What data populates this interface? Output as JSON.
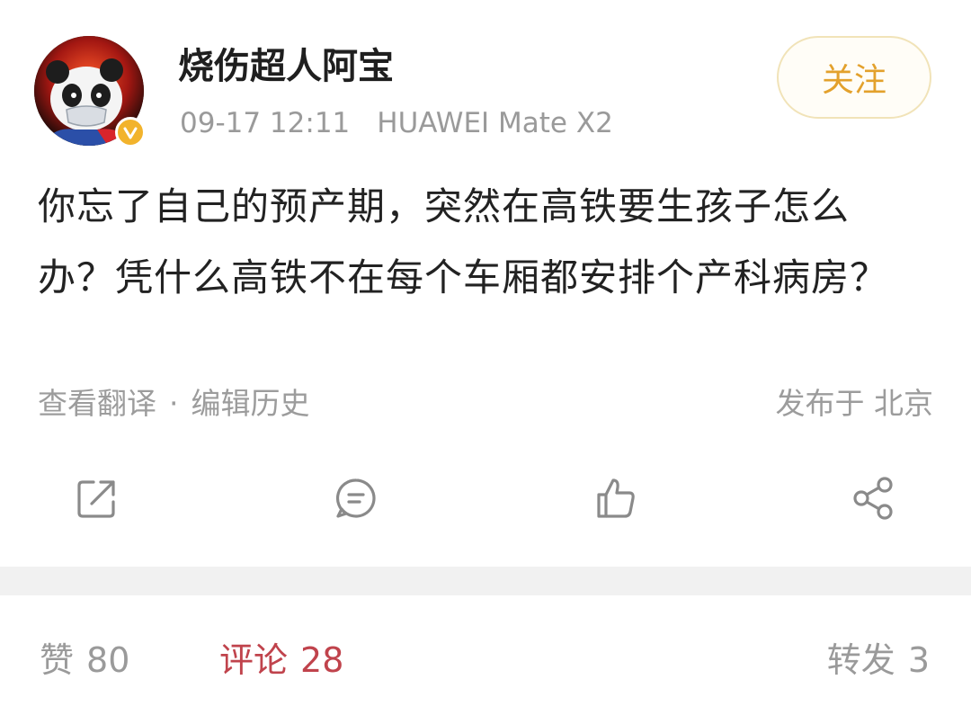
{
  "user": {
    "name": "烧伤超人阿宝",
    "timestamp": "09-17 12:11",
    "device": "HUAWEI Mate X2",
    "verified": true,
    "avatar": "panda-avatar-icon",
    "verified_icon": "verified-badge-icon"
  },
  "follow_button": {
    "label": "关注",
    "color": "#e3a12c"
  },
  "post": {
    "text": "你忘了自己的预产期，突然在高铁要生孩子怎么办？凭什么高铁不在每个车厢都安排个产科病房？"
  },
  "footer": {
    "translate": "查看翻译",
    "separator": "·",
    "edit_history": "编辑历史",
    "location": "发布于 北京"
  },
  "actions": [
    {
      "name": "repost",
      "icon": "repost-icon"
    },
    {
      "name": "comment",
      "icon": "comment-icon"
    },
    {
      "name": "like",
      "icon": "like-icon"
    },
    {
      "name": "share",
      "icon": "share-icon"
    }
  ],
  "stats": {
    "likes_label": "赞",
    "likes_count": "80",
    "comments_label": "评论",
    "comments_count": "28",
    "reposts_label": "转发",
    "reposts_count": "3",
    "active_color": "#c0434c"
  }
}
